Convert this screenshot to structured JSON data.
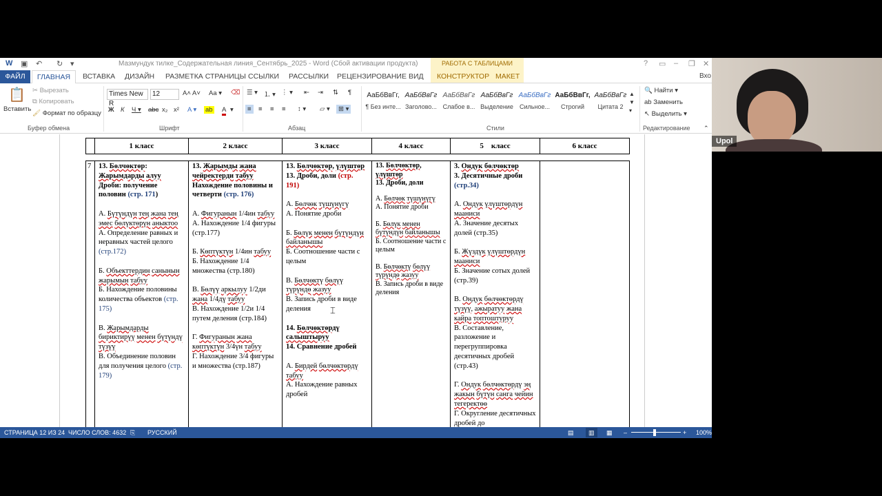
{
  "window": {
    "doc_title": "Мазмундук тилке_Содержательная линия_Сентябрь_2025 - Word (Сбой активации продукта)",
    "context_title": "РАБОТА С ТАБЛИЦАМИ",
    "help": "?",
    "minimize": "–",
    "restore": "❐",
    "close": "✕"
  },
  "tabs": {
    "file": "ФАЙЛ",
    "home": "ГЛАВНАЯ",
    "insert": "ВСТАВКА",
    "design": "ДИЗАЙН",
    "layout": "РАЗМЕТКА СТРАНИЦЫ",
    "refs": "ССЫЛКИ",
    "mail": "РАССЫЛКИ",
    "review": "РЕЦЕНЗИРОВАНИЕ",
    "view": "ВИД",
    "constructor": "КОНСТРУКТОР",
    "table_layout": "МАКЕТ",
    "signin": "Вхо"
  },
  "clipboard": {
    "paste": "Вставить",
    "cut": "Вырезать",
    "copy": "Копировать",
    "format": "Формат по образцу",
    "group": "Буфер обмена"
  },
  "font": {
    "name": "Times New R",
    "size": "12",
    "group": "Шрифт"
  },
  "paragraph": {
    "group": "Абзац"
  },
  "styles": {
    "group": "Стили",
    "items": [
      {
        "sample": "АаБбВвГг,",
        "name": "¶ Без инте..."
      },
      {
        "sample": "АаБбВвГг",
        "name": "Заголово..."
      },
      {
        "sample": "АаБбВвГг",
        "name": "Слабое в..."
      },
      {
        "sample": "АаБбВвГг",
        "name": "Выделение"
      },
      {
        "sample": "АаБбВвГг",
        "name": "Сильное..."
      },
      {
        "sample": "АаБбВвГг,",
        "name": "Строгий"
      },
      {
        "sample": "АаБбВвГг",
        "name": "Цитата 2"
      }
    ]
  },
  "editing": {
    "find": "Найти",
    "replace": "Заменить",
    "select": "Выделить",
    "group": "Редактирование"
  },
  "table": {
    "headers": [
      "1 класс",
      "2 класс",
      "3 класс",
      "4 класс",
      "5    класс",
      "6 класс"
    ],
    "row_num": "7"
  },
  "status": {
    "page": "СТРАНИЦА 12 ИЗ 24",
    "words": "ЧИСЛО СЛОВ: 4632",
    "lang": "РУССКИЙ",
    "zoom": "100%"
  },
  "webcam": {
    "name": "Upol"
  }
}
